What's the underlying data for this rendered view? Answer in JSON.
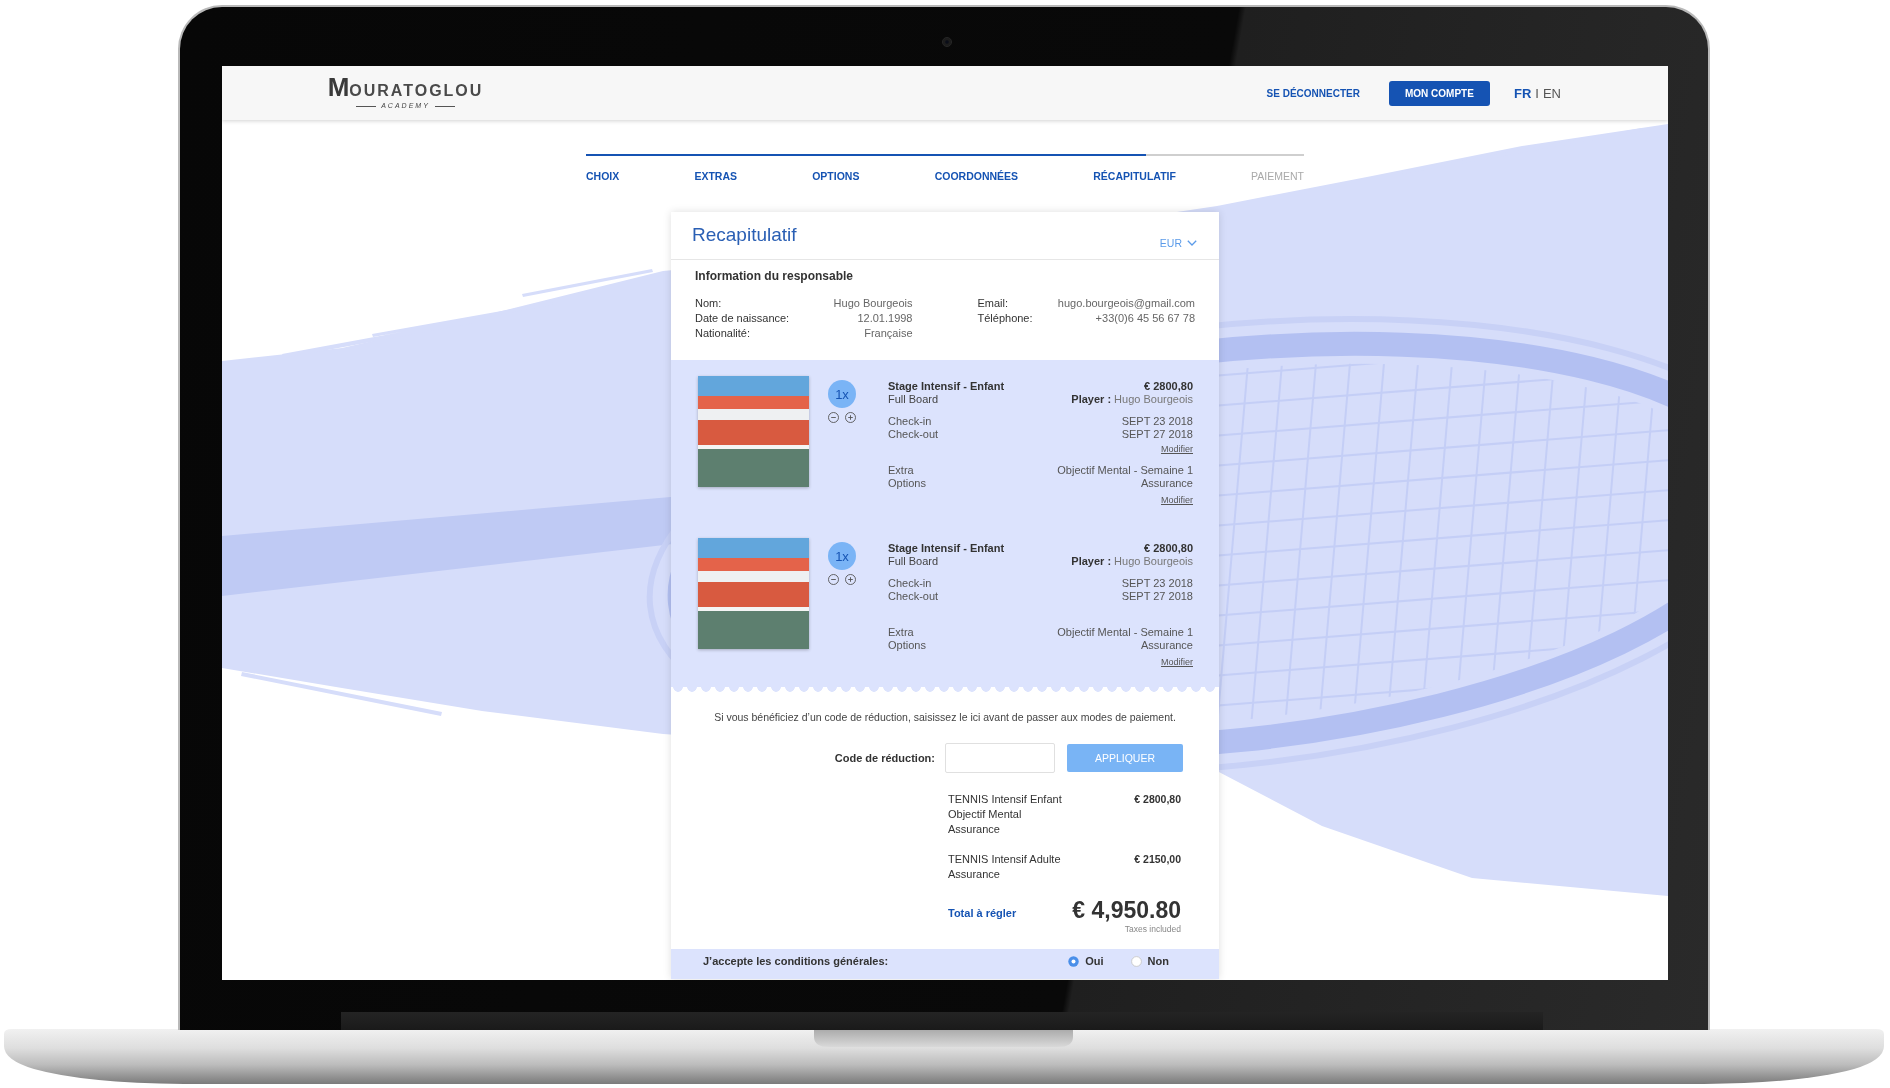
{
  "header": {
    "logo": {
      "initial": "M",
      "name": "OURATOGLOU",
      "tagline": "ACADEMY"
    },
    "logout": "SE DÉCONNECTER",
    "account": "MON COMPTE",
    "languages": [
      {
        "label": "FR",
        "selected": true
      },
      {
        "label": "EN",
        "selected": false
      }
    ],
    "language_separator": "I"
  },
  "steps": [
    {
      "label": "CHOIX",
      "reached": true
    },
    {
      "label": "EXTRAS",
      "reached": true
    },
    {
      "label": "OPTIONS",
      "reached": true
    },
    {
      "label": "COORDONNÉES",
      "reached": true
    },
    {
      "label": "RÉCAPITULATIF",
      "reached": true
    },
    {
      "label": "PAIEMENT",
      "reached": false
    }
  ],
  "steps_progress": {
    "level": 0.78
  },
  "card": {
    "title": "Recapitulatif",
    "currency": "EUR",
    "responsible": {
      "title": "Information du responsable",
      "columns": [
        [
          {
            "label": "Nom:",
            "value": "Hugo Bourgeois"
          },
          {
            "label": "Date de naissance:",
            "value": "12.01.1998"
          },
          {
            "label": "Nationalité:",
            "value": "Française"
          }
        ],
        [
          {
            "label": "Email:",
            "value": "hugo.bourgeois@gmail.com"
          },
          {
            "label": "Téléphone:",
            "value": "+33(0)6 45 56 67 78"
          }
        ]
      ]
    },
    "items": [
      {
        "quantity": "1x",
        "title": "Stage Intensif - Enfant",
        "price": "€ 2800,80",
        "subtitle": "Full Board",
        "player": "**Player :** Hugo Bourgeois",
        "dates": [
          {
            "label": "Check-in",
            "value": "SEPT 23 2018"
          },
          {
            "label": "Check-out",
            "value": "SEPT 27 2018"
          }
        ],
        "dates_link": "Modifier",
        "extras": [
          {
            "label": "Extra",
            "value": "Objectif Mental - Semaine 1"
          },
          {
            "label": "Options",
            "value": "Assurance"
          }
        ],
        "extras_link": "Modifier"
      },
      {
        "quantity": "1x",
        "title": "Stage Intensif - Enfant",
        "price": "€ 2800,80",
        "subtitle": "Full Board",
        "player": "**Player :** Hugo Bourgeois",
        "dates": [
          {
            "label": "Check-in",
            "value": "SEPT 23 2018"
          },
          {
            "label": "Check-out",
            "value": "SEPT 27 2018"
          }
        ],
        "extras": [
          {
            "label": "Extra",
            "value": "Objectif Mental - Semaine 1"
          },
          {
            "label": "Options",
            "value": "Assurance"
          }
        ],
        "extras_link": "Modifier"
      }
    ],
    "discount": {
      "hint": "Si vous bénéficiez d’un code de réduction, saisissez le ici avant de passer aux modes de paiement.",
      "label": "Code de réduction:",
      "button": "APPLIQUER"
    },
    "summary": [
      {
        "lines": [
          "TENNIS Intensif Enfant",
          "Objectif Mental",
          "Assurance"
        ],
        "price": "€ 2800,80"
      },
      {
        "lines": [
          "TENNIS Intensif Adulte",
          "Assurance"
        ],
        "price": "€ 2150,00"
      }
    ],
    "total": {
      "label": "Total à régler",
      "amount": "€ 4,950.80",
      "note": "Taxes included"
    },
    "terms": {
      "label": "J’accepte les conditions générales:",
      "options": [
        {
          "label": "Oui",
          "selected": true
        },
        {
          "label": "Non",
          "selected": false
        }
      ]
    }
  }
}
